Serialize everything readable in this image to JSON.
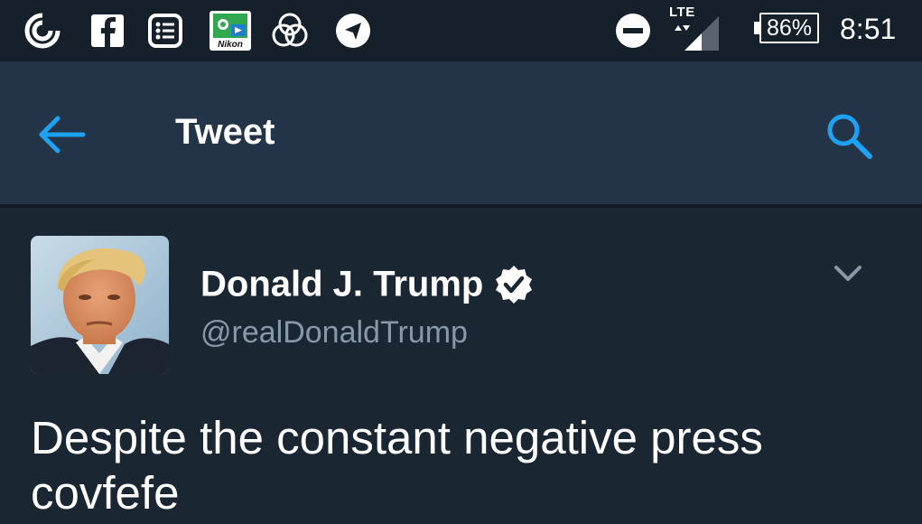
{
  "status_bar": {
    "icons": [
      "pocketcasts-icon",
      "facebook-icon",
      "list-icon",
      "nikon-snapbridge-icon",
      "venn-circles-icon",
      "telegram-icon"
    ],
    "nikon_label": "Nikon",
    "right_icons": [
      "do-not-disturb-icon",
      "lte-signal-icon"
    ],
    "network": "LTE",
    "battery": "86%",
    "time": "8:51"
  },
  "app_bar": {
    "back_icon": "arrow-left-icon",
    "title": "Tweet",
    "search_icon": "search-icon"
  },
  "tweet": {
    "author_name": "Donald J. Trump",
    "verified_icon": "verified-badge-icon",
    "handle": "@realDonaldTrump",
    "menu_icon": "chevron-down-icon",
    "text_line1": "Despite the constant negative press",
    "text_line2": "covfefe"
  },
  "colors": {
    "status_bar_bg": "#15202b",
    "app_bar_bg": "#243447",
    "content_bg": "#1b2633",
    "accent": "#1da1f2",
    "secondary_text": "#8899a6"
  }
}
